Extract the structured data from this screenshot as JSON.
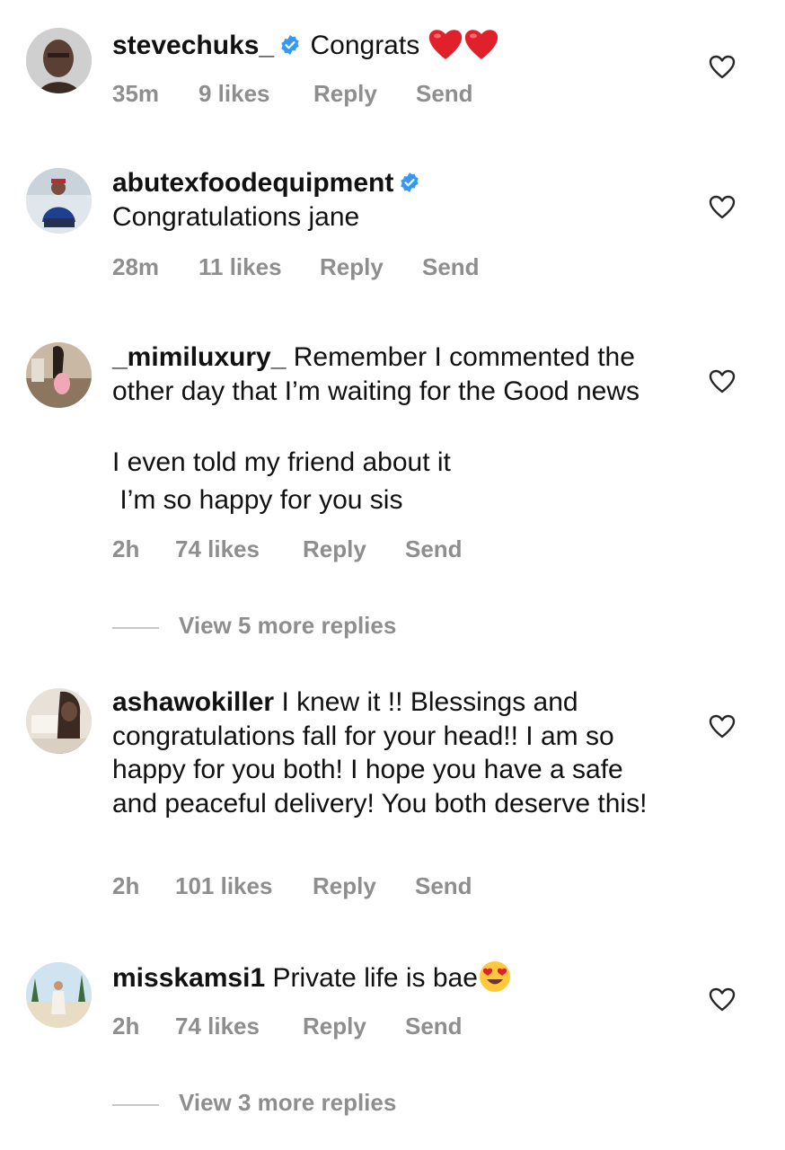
{
  "comments": [
    {
      "username": "stevechuks_",
      "verified": true,
      "text": "Congrats",
      "emoji": [
        "red-heart",
        "red-heart"
      ],
      "time": "35m",
      "likes": "9 likes",
      "reply": "Reply",
      "send": "Send"
    },
    {
      "username": "abutexfoodequipment",
      "verified": true,
      "text": "Congratulations jane",
      "time": "28m",
      "likes": "11 likes",
      "reply": "Reply",
      "send": "Send"
    },
    {
      "username": "_mimiluxury_",
      "verified": false,
      "text": "Remember I commented the other day that I’m waiting for the Good news",
      "text_line2": "I even told my friend about it",
      "text_line3": " I’m so happy for you sis",
      "time": "2h",
      "likes": "74 likes",
      "reply": "Reply",
      "send": "Send",
      "view_more": "View 5 more replies"
    },
    {
      "username": "ashawokiller",
      "verified": false,
      "text": "I knew it !! Blessings and congratulations fall for your head!! I am so happy for you both! I hope you have a safe and peaceful delivery! You both deserve this!",
      "time": "2h",
      "likes": "101 likes",
      "reply": "Reply",
      "send": "Send"
    },
    {
      "username": "misskamsi1",
      "verified": false,
      "text": "Private life is bae",
      "emoji": [
        "heart-eyes-face"
      ],
      "time": "2h",
      "likes": "74 likes",
      "reply": "Reply",
      "send": "Send",
      "view_more": "View 3 more replies"
    }
  ],
  "colors": {
    "text": "#111111",
    "meta": "#8e8e8e",
    "verified": "#3897f0",
    "emoji_heart": "#e0202b"
  }
}
